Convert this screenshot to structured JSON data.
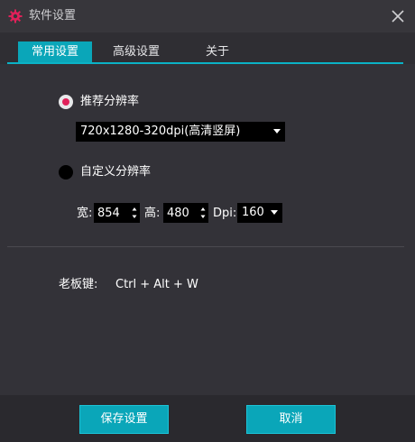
{
  "window": {
    "title": "软件设置",
    "app_icon": "gear-icon",
    "close_icon": "close-icon"
  },
  "tabs": [
    {
      "label": "常用设置",
      "active": true
    },
    {
      "label": "高级设置",
      "active": false
    },
    {
      "label": "关于",
      "active": false
    }
  ],
  "resolution": {
    "recommended_label": "推荐分辨率",
    "recommended_checked": true,
    "recommended_value": "720x1280-320dpi(高清竖屏)",
    "custom_label": "自定义分辨率",
    "custom_checked": false,
    "width_label": "宽:",
    "width_value": "854",
    "height_label": "高:",
    "height_value": "480",
    "dpi_label": "Dpi:",
    "dpi_value": "160"
  },
  "boss_key": {
    "label": "老板键:",
    "value": "Ctrl + Alt + W"
  },
  "buttons": {
    "save": "保存设置",
    "cancel": "取消"
  },
  "colors": {
    "accent": "#0aa6b9",
    "radio_dot": "#e0215a",
    "background": "#2f2e33"
  }
}
